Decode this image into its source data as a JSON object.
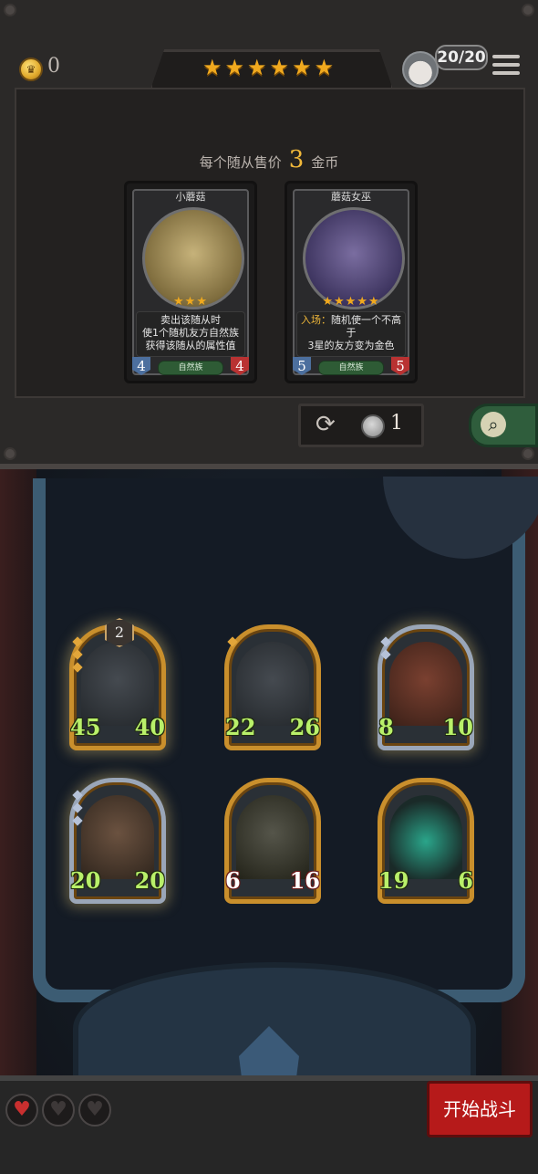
{
  "header": {
    "coins": "0",
    "tier_stars": [
      "★",
      "★",
      "★",
      "★",
      "★",
      "★"
    ],
    "player_count": "20/20",
    "menu_icon": "hamburger-menu-icon"
  },
  "shop": {
    "price_prefix": "每个随从售价",
    "price_value": "3",
    "price_suffix": "金币",
    "cards": [
      {
        "name": "小蘑菇",
        "stars": "★★★",
        "text_lines": [
          "卖出该随从时",
          "使1个随机友方自然族",
          "获得该随从的属性值"
        ],
        "attack": "4",
        "health": "4",
        "race": "自然族"
      },
      {
        "name": "蘑菇女巫",
        "stars": "★★★★★",
        "keyword": "入场：",
        "text_lines": [
          "随机使一个不高于",
          "3星的友方变为金色"
        ],
        "attack": "5",
        "health": "5",
        "race": "自然族"
      }
    ],
    "refresh_icon": "refresh-icon",
    "refresh_cost": "1",
    "search_icon": "magnifier-icon"
  },
  "board": {
    "minions": [
      {
        "attack": "45",
        "health": "40",
        "level": "2",
        "frame": "gold"
      },
      {
        "attack": "22",
        "health": "26",
        "frame": "gold"
      },
      {
        "attack": "8",
        "health": "10",
        "frame": "silver"
      },
      {
        "attack": "20",
        "health": "20",
        "frame": "silver"
      },
      {
        "attack": "6",
        "health": "16",
        "frame": "gold"
      },
      {
        "attack": "19",
        "health": "6",
        "frame": "gold"
      }
    ]
  },
  "footer": {
    "hearts": [
      "♥",
      "♥",
      "♥"
    ],
    "start_label": "开始战斗"
  }
}
